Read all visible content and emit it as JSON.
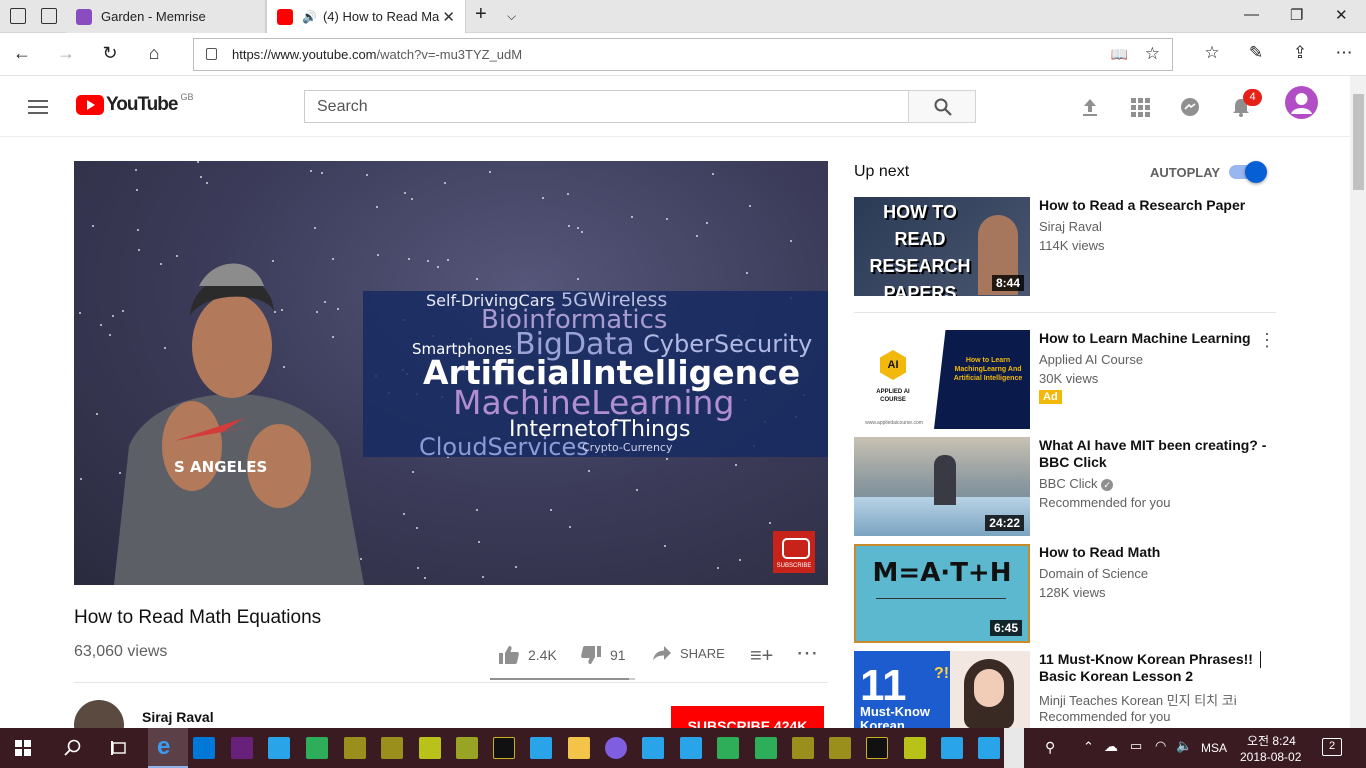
{
  "browser": {
    "tabs": [
      {
        "title": "Garden - Memrise",
        "favicon_color": "#8a4dbf",
        "active": false
      },
      {
        "title": "(4) How to Read Ma",
        "favicon_color": "#ff0000",
        "active": true
      }
    ],
    "url": "https://www.youtube.com/watch?v=-mu3TYZ_udM",
    "url_host": "https://www.youtube.com",
    "url_path": "/watch?v=-mu3TYZ_udM"
  },
  "header": {
    "logo_text": "YouTube",
    "country_code": "GB",
    "search_placeholder": "Search",
    "notification_count": "4",
    "accent": "#ff0000"
  },
  "video": {
    "title": "How to Read Math Equations",
    "views": "63,060 views",
    "likes": "2.4K",
    "dislikes": "91",
    "share_label": "SHARE",
    "wordcloud": [
      "Self-DrivingCars",
      "5GWireless",
      "Bioinformatics",
      "Smartphones",
      "BigData",
      "CyberSecurity",
      "ArtificialIntelligence",
      "MachineLearning",
      "InternetofThings",
      "CloudServices",
      "Crypto-Currency"
    ],
    "shirt_text": "S ANGELES",
    "watermark_text": "SUBSCRIBE",
    "like_ratio": 0.96
  },
  "channel": {
    "name": "Siraj Raval",
    "subscribe_label": "SUBSCRIBE 424K"
  },
  "sidebar": {
    "up_next": "Up next",
    "autoplay_label": "AUTOPLAY",
    "autoplay_on": true,
    "items": [
      {
        "title": "How to Read a Research Paper",
        "channel": "Siraj Raval",
        "meta": "114K views",
        "duration": "8:44",
        "thumb_text": "HOW TO READ RESEARCH PAPERS"
      },
      {
        "title": "How to Learn Machine Learning",
        "channel": "Applied AI Course",
        "meta": "30K views",
        "badge": "Ad",
        "thumb_logo": "AI",
        "thumb_brand": "APPLIED AI COURSE",
        "thumb_text": "How to Learn MachingLearng And Artificial Intelligence",
        "thumb_url": "www.appliedaicourse.com"
      },
      {
        "title": "What AI have MIT been creating? - BBC Click",
        "channel": "BBC Click",
        "meta": "Recommended for you",
        "duration": "24:22"
      },
      {
        "title": "How to Read Math",
        "channel": "Domain of Science",
        "meta": "128K views",
        "duration": "6:45",
        "thumb_text": "M=A·T+H"
      },
      {
        "title": "11 Must-Know Korean Phrases!! │ Basic Korean Lesson 2",
        "channel": "Minji Teaches Korean 민지 티치 코i",
        "meta": "Recommended for you",
        "thumb_num": "11",
        "thumb_sub": "Must-Know Korean",
        "thumb_mark": "?!"
      }
    ]
  },
  "taskbar": {
    "ime": "MSA",
    "time": "오전 8:24",
    "date": "2018-08-02",
    "notifications": "2"
  }
}
